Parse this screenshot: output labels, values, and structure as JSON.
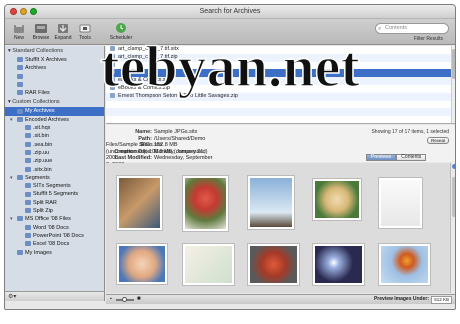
{
  "window": {
    "title": "Search for Archives"
  },
  "toolbar": {
    "buttons": [
      {
        "label": "New",
        "icon": "new-icon"
      },
      {
        "label": "Browse",
        "icon": "browse-icon"
      },
      {
        "label": "Expand",
        "icon": "expand-icon"
      },
      {
        "label": "Tools",
        "icon": "tools-icon"
      },
      {
        "label": "Scheduler",
        "icon": "scheduler-icon"
      }
    ],
    "search_placeholder": "Contents",
    "filter_label": "Filter Results"
  },
  "sidebar": {
    "standard_header": "Standard Collections",
    "standard_items": [
      "StuffIt X Archives",
      "Archives",
      "",
      "",
      "RAR Files"
    ],
    "custom_header": "Custom Collections",
    "custom_items": [
      {
        "label": "My Archives",
        "level": 1,
        "selected": true
      },
      {
        "label": "Encoded Archives",
        "level": 1
      },
      {
        "label": ".sit.hqx",
        "level": 2
      },
      {
        "label": ".sit.bin",
        "level": 2
      },
      {
        "label": ".sea.bin",
        "level": 2
      },
      {
        "label": ".zip.uu",
        "level": 2
      },
      {
        "label": ".zip.uue",
        "level": 2
      },
      {
        "label": ".sitx.bin",
        "level": 2
      },
      {
        "label": "Segments",
        "level": 1
      },
      {
        "label": "SITx Segments",
        "level": 2
      },
      {
        "label": "StuffIt 5 Segments",
        "level": 2
      },
      {
        "label": "Split RAR",
        "level": 2
      },
      {
        "label": "Split Zip",
        "level": 2
      },
      {
        "label": "MS Office '08 Files",
        "level": 1
      },
      {
        "label": "Word '08 Docs",
        "level": 2
      },
      {
        "label": "PowerPoint '08 Docs",
        "level": 2
      },
      {
        "label": "Excel '08 Docs",
        "level": 2
      },
      {
        "label": "My Images",
        "level": 1
      }
    ]
  },
  "files": [
    {
      "name": "art_clamp_color_7.tif.sitx",
      "selected": false
    },
    {
      "name": "art_clamp_color_7.tif.zip",
      "selected": false
    },
    {
      "name": "",
      "selected": false
    },
    {
      "name": "",
      "selected": true
    },
    {
      "name": "eBooks & Comics.sitx",
      "selected": false
    },
    {
      "name": "eBooks & Comics.zip",
      "selected": false
    },
    {
      "name": "Ernest Thompson Seton – Two Little Savages.zip",
      "selected": false
    },
    {
      "name": "",
      "selected": false
    },
    {
      "name": "",
      "selected": false
    }
  ],
  "info": {
    "name_key": "Name:",
    "name_val": "Sample JPGs.sitx",
    "path_key": "Path:",
    "path_val": "/Users/Shared/Demo Files/Sample JPGs.sitx",
    "size_key": "Size:",
    "size_val": "152.8 MB (uncompressed), 108.8 MB (compressed)",
    "created_key": "Creation Date:",
    "created_val": "Monday, January 21, 2008",
    "modified_key": "Last Modified:",
    "modified_val": "Wednesday, September 3, 2008",
    "showing": "Showing 17 of 17 items, 1 selected",
    "reveal": "Reveal"
  },
  "tabs": {
    "previews": "Previews",
    "contents": "Contents"
  },
  "status": {
    "preview_label": "Preview Images Under:",
    "size": "512 KB"
  },
  "watermark": "tebyan.net"
}
